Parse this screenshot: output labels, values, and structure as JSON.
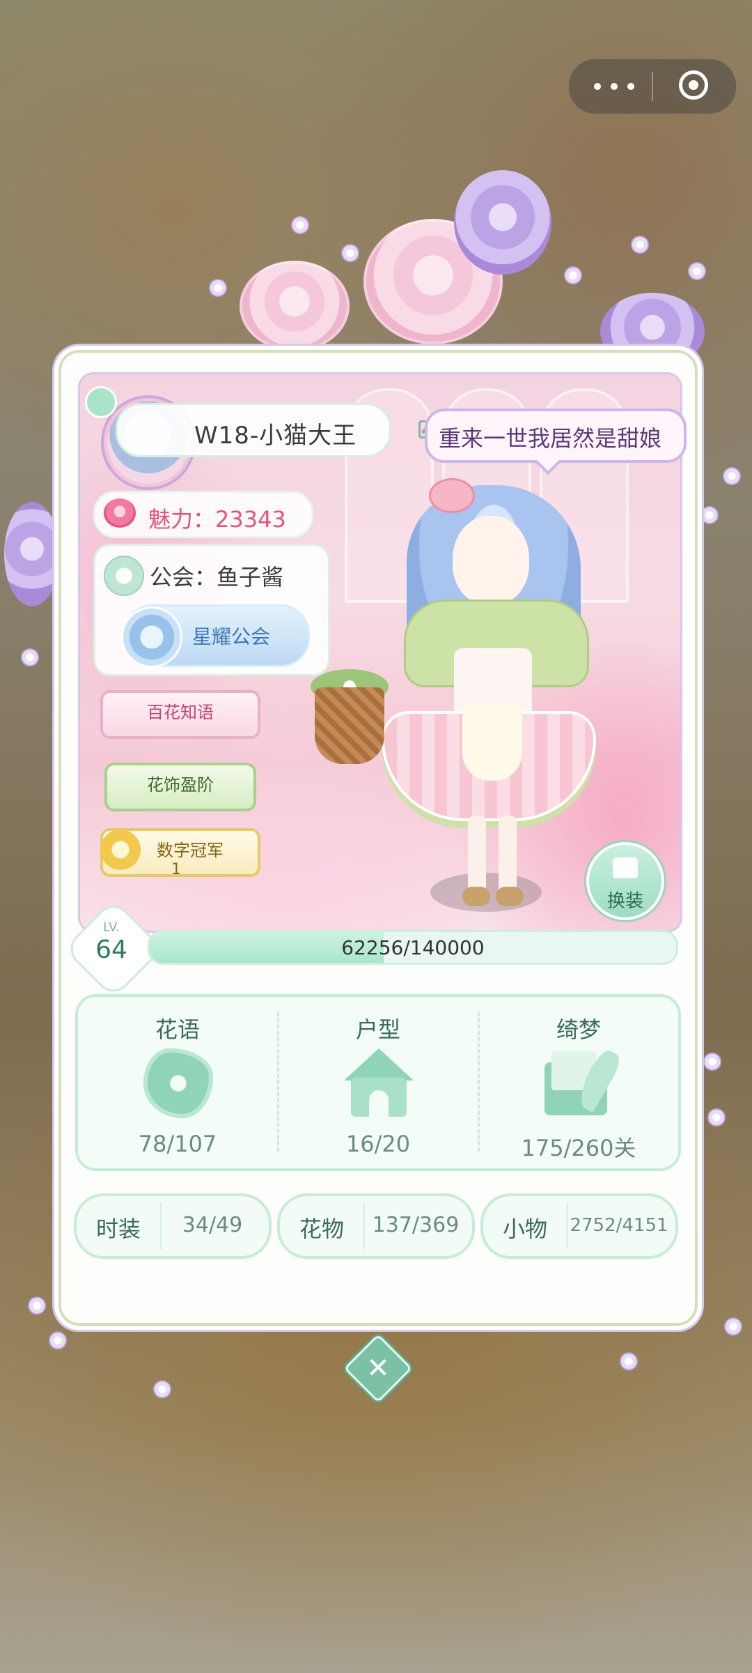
{
  "player": {
    "name": "W18-小猫大王",
    "charm_label": "魅力：23343",
    "guild_label": "公会：鱼子酱",
    "guild_badge": "星耀公会",
    "titles": [
      "百花知语",
      "花饰盈阶",
      "数字冠军"
    ],
    "title_medal_number": "1"
  },
  "speech_bubble": "重来一世我居然是甜娘",
  "change_outfit_label": "换装",
  "level": {
    "lv_label": "LV.",
    "value": "64",
    "progress_text": "62256/140000",
    "progress_fraction": 0.4447
  },
  "stats": [
    {
      "title": "花语",
      "value": "78/107",
      "icon": "flower-icon"
    },
    {
      "title": "户型",
      "value": "16/20",
      "icon": "house-icon"
    },
    {
      "title": "绮梦",
      "value": "175/260关",
      "icon": "letter-quill-icon"
    }
  ],
  "counters": [
    {
      "label": "时装",
      "value": "34/49"
    },
    {
      "label": "花物",
      "value": "137/369"
    },
    {
      "label": "小物",
      "value": "2752/4151"
    }
  ],
  "colors": {
    "accent_green": "#8fd4b8",
    "charm_pink": "#e8507a",
    "guild_blue": "#3d77b9",
    "bubble_purple": "#5a3c78"
  }
}
